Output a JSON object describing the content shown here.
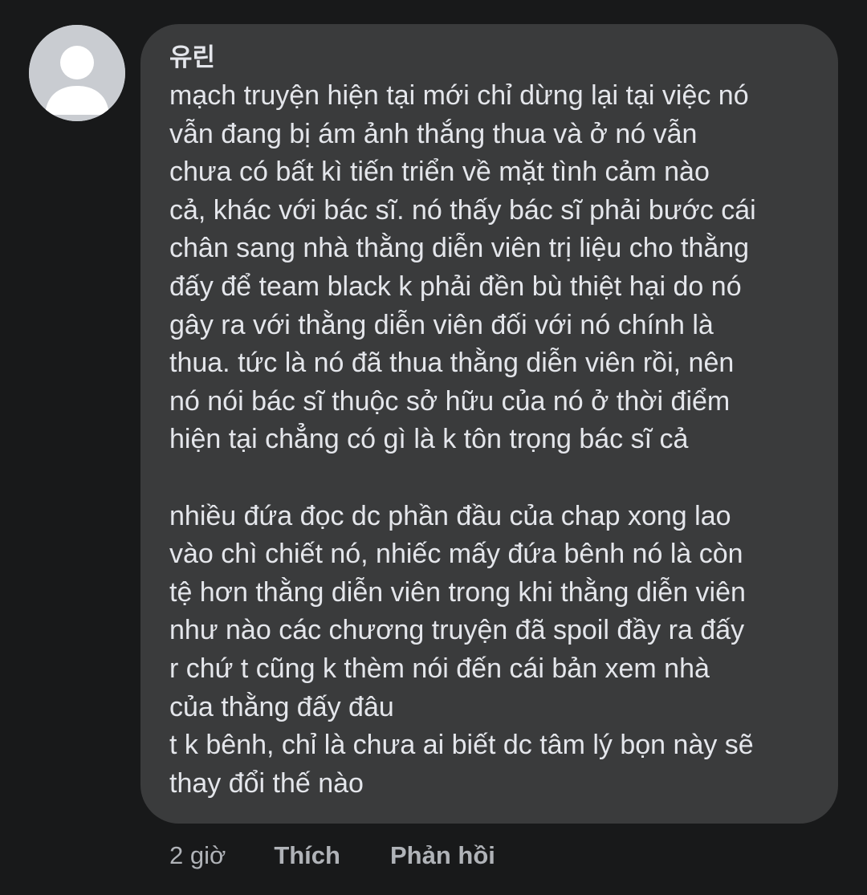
{
  "comment": {
    "author": "유린",
    "lines": [
      "mạch truyện hiện tại mới chỉ dừng lại tại việc nó",
      "vẫn đang bị ám ảnh thắng thua và ở nó vẫn",
      "chưa có bất kì tiến triển về mặt tình cảm nào",
      "cả, khác với bác sĩ. nó thấy bác sĩ phải bước cái",
      "chân sang nhà thằng diễn viên trị liệu cho thằng",
      "đấy để team black k phải đền bù thiệt hại do nó",
      "gây ra với thằng diễn viên đối với nó chính là",
      "thua. tức là nó đã thua thằng diễn viên rồi, nên",
      "nó nói bác sĩ thuộc sở hữu của nó ở thời điểm",
      "hiện tại chẳng có gì là k tôn trọng bác sĩ cả",
      "",
      "nhiều đứa đọc dc phần đầu của chap xong lao",
      "vào chì chiết nó, nhiếc mấy đứa bênh nó là còn",
      "tệ hơn thằng diễn viên trong khi thằng diễn viên",
      "như nào các chương truyện đã spoil đầy ra đấy",
      "r chứ t cũng k thèm nói đến cái bản xem nhà",
      "của thằng đấy đâu",
      "t k bênh, chỉ là chưa ai biết dc tâm lý bọn này sẽ",
      "thay đổi thế nào"
    ]
  },
  "actions": {
    "time": "2 giờ",
    "like": "Thích",
    "reply": "Phản hồi"
  },
  "colors": {
    "background": "#18191a",
    "bubble": "#3a3b3c",
    "text": "#e4e6eb",
    "secondary_text": "#b0b3b8",
    "avatar_bg": "#c9ccd1"
  },
  "icons": {
    "avatar": "default-profile-silhouette-icon"
  }
}
